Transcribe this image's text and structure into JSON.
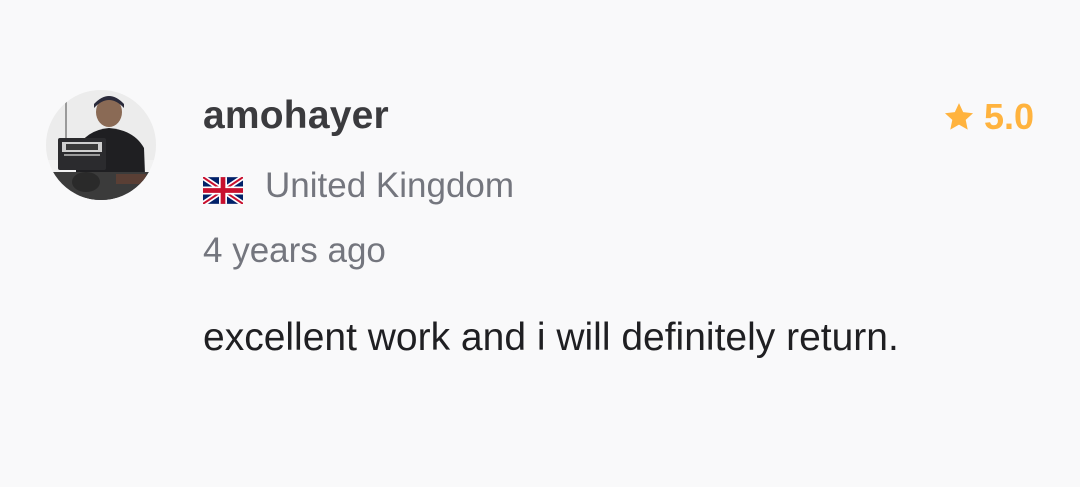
{
  "review": {
    "username": "amohayer",
    "rating": "5.0",
    "country": "United Kingdom",
    "time_ago": "4 years ago",
    "text": "excellent work and i will definitely return."
  },
  "icons": {
    "rating": "star-icon",
    "country": "uk-flag-icon",
    "avatar": "user-avatar"
  },
  "colors": {
    "rating": "#ffb33e",
    "username": "#3b3b3e",
    "muted": "#74767e",
    "body_text": "#1f1f22",
    "background": "#f9f9fa"
  }
}
